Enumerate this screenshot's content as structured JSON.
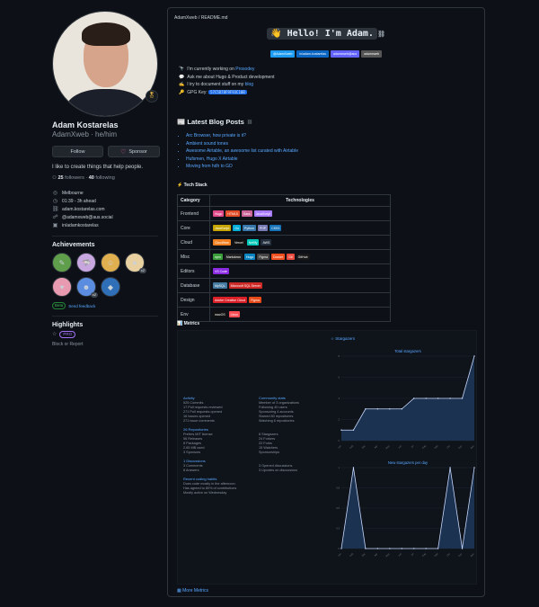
{
  "profile": {
    "name": "Adam Kostarelas",
    "username": "AdamXweb · he/him",
    "status_emoji": "🎖",
    "follow_label": "Follow",
    "sponsor_label": "Sponsor",
    "bio": "I like to create things that help people.",
    "followers_count": "25",
    "followers_label": "followers ·",
    "following_count": "40",
    "following_label": "following",
    "details": [
      {
        "icon": "location-icon",
        "glyph": "◎",
        "text": "Melbourne"
      },
      {
        "icon": "clock-icon",
        "glyph": "◷",
        "text": "01:39 - 3h ahead"
      },
      {
        "icon": "link-icon",
        "glyph": "⛓",
        "text": "adam.kostarelas.com"
      },
      {
        "icon": "mastodon-icon",
        "glyph": "☍",
        "text": "@adamxweb@aus.social"
      },
      {
        "icon": "linkedin-icon",
        "glyph": "▣",
        "text": "in/adamkostarelas"
      }
    ],
    "achievements_title": "Achievements",
    "achievements_row1": [
      {
        "name": "yolo-badge",
        "glyph": "✎",
        "bg": "#5f9e4a",
        "count": ""
      },
      {
        "name": "pull-shark-badge",
        "glyph": "🦈",
        "bg": "#c8a6e0",
        "count": ""
      },
      {
        "name": "quickdraw-badge",
        "glyph": "☺",
        "bg": "#e0b050",
        "count": ""
      },
      {
        "name": "starstruck-badge",
        "glyph": "★",
        "bg": "#e8d0a0",
        "count": "x2"
      }
    ],
    "achievements_row2": [
      {
        "name": "public-sponsor-badge",
        "glyph": "♥",
        "bg": "#e89ab0",
        "count": ""
      },
      {
        "name": "pair-extraordinaire-badge",
        "glyph": "☻",
        "bg": "#5a8de0",
        "count": "x2"
      },
      {
        "name": "arctic-code-vault-badge",
        "glyph": "◆",
        "bg": "#2f6fb8",
        "count": ""
      }
    ],
    "beta_tag": "Beta",
    "beta_text": "Send feedback",
    "highlights_title": "Highlights",
    "pro_label": "PRO",
    "block_report": "Block or Report"
  },
  "readme": {
    "path": "AdamXweb / README.md",
    "hello_text": "👋 Hello! I'm Adam.",
    "social": [
      {
        "label": "@AdamXweb",
        "color": "#1d9bf0"
      },
      {
        "label": "in/adam-kostarelas",
        "color": "#0a66c2"
      },
      {
        "label": "adamxweb@aus",
        "color": "#6364ff"
      },
      {
        "label": "adamxweb",
        "color": "#555"
      }
    ],
    "intro": [
      {
        "glyph": "🔭",
        "text": "I'm currently working on ",
        "link": "Prosodey"
      },
      {
        "glyph": "💬",
        "text": "Ask me about Hugo & Product development",
        "link": ""
      },
      {
        "glyph": "✍",
        "text": "I try to document stuff on my ",
        "link": "blog"
      },
      {
        "glyph": "🔑",
        "text": "GPG Key: ",
        "link": "",
        "code": "57C5D78F9F93C10B"
      }
    ],
    "blog_title": "📰 Latest Blog Posts",
    "blog_posts": [
      "Arc Browser, how private is it?",
      "Ambient sound tones",
      "Awesome Airtable, an awesome list curated with Airtable",
      "Hufsmen, Hugo X Airtable",
      "Moving from hdh to GD"
    ],
    "tech_title": "⚡ Tech Stack",
    "tech_headers": [
      "Category",
      "Technologies"
    ],
    "tech_rows": [
      {
        "category": "Frontend",
        "chips": [
          [
            "Hugo",
            "#e0498a"
          ],
          [
            "HTML5",
            "#e34c26"
          ],
          [
            "Sass",
            "#cc6699"
          ],
          [
            "JavaScript",
            "#a97bff"
          ]
        ]
      },
      {
        "category": "Core",
        "chips": [
          [
            "JavaScript",
            "#c5a400"
          ],
          [
            "Go",
            "#00add8"
          ],
          [
            "Python",
            "#3776ab"
          ],
          [
            "PHP",
            "#777bb4"
          ],
          [
            "CSS3",
            "#1572b6"
          ]
        ]
      },
      {
        "category": "Cloud",
        "chips": [
          [
            "Cloudflare",
            "#f38020"
          ],
          [
            "Vercel",
            "#111111"
          ],
          [
            "Netlify",
            "#00c7b7"
          ],
          [
            "AWS",
            "#232f3e"
          ]
        ]
      },
      {
        "category": "Misc",
        "chips": [
          [
            "npm",
            "#3a9e3a"
          ],
          [
            "Markdown",
            "#222222"
          ],
          [
            "Hugo",
            "#0a84c1"
          ],
          [
            "Figma",
            "#444444"
          ],
          [
            "Docker",
            "#f24e1e"
          ],
          [
            "Git",
            "#e94a3b"
          ],
          [
            "GitHub",
            "#181717"
          ]
        ]
      },
      {
        "category": "Editors",
        "chips": [
          [
            "VS Code",
            "#8a2be2"
          ]
        ]
      },
      {
        "category": "Database",
        "chips": [
          [
            "MySQL",
            "#4479a1"
          ],
          [
            "Microsoft SQL Server",
            "#cc2927"
          ]
        ]
      },
      {
        "category": "Design",
        "chips": [
          [
            "Adobe Creative Cloud",
            "#da1f26"
          ],
          [
            "Figma",
            "#e64a19"
          ]
        ]
      },
      {
        "category": "Env",
        "chips": [
          [
            "macOS",
            "#111111"
          ],
          [
            "Linux",
            "#fa4d56"
          ]
        ]
      }
    ],
    "metrics_title": "📊 Metrics",
    "more_metrics": "More Metrics",
    "metrics": {
      "activity_head": "Activity",
      "activity": [
        "525 Commits",
        "17 Pull requests reviewed",
        "271 Pull requests opened",
        "16 Issues opened",
        "271 issue comments"
      ],
      "community_head": "Community stats",
      "community": [
        "Member of 3 organizations",
        "Following 40 users",
        "Sponsoring 4 accounts",
        "Starred 80 repositories",
        "Watching 6 repositories"
      ],
      "repos_head": "26 Repositories",
      "repos": [
        "Prefers MIT license",
        "56 Releases",
        "8 Packages",
        "2.65 MB used",
        "3 Sponsors"
      ],
      "repos_right": [
        "8 Stargazers",
        "24 Forkers",
        "22 Forks",
        "15 Watchers",
        "Sponsorships"
      ],
      "issues_head": "1 Discussions",
      "issues": [
        "3 Comments",
        "8 Answers"
      ],
      "issues_right": [
        "3 Opened discussions",
        "3 Upvotes on discussions"
      ],
      "recent_head": "Recent coding habits",
      "recent": [
        "Does code mostly in the afternoon",
        "Has agreed to 80% of contributions",
        "Mostly active on Wednesday"
      ],
      "chart1_title": "Total stargazers",
      "chart2_title": "New stargazers per day"
    },
    "chart_data": [
      {
        "type": "area",
        "title": "Total stargazers",
        "x": [
          "Jan",
          "Feb",
          "Mar",
          "Apr",
          "May",
          "Jun",
          "Jul",
          "Aug",
          "Sep",
          "Oct",
          "Nov",
          "Dec"
        ],
        "values": [
          1,
          1,
          3,
          3,
          3,
          3,
          4,
          4,
          4,
          4,
          4,
          8
        ],
        "ylim": [
          0,
          8
        ]
      },
      {
        "type": "area",
        "title": "New stargazers per day",
        "x": [
          "Jan",
          "Feb",
          "Mar",
          "Apr",
          "May",
          "Jun",
          "Jul",
          "Aug",
          "Sep",
          "Oct",
          "Nov",
          "Dec"
        ],
        "values": [
          0,
          1,
          0,
          0,
          0,
          0,
          0,
          0,
          0,
          1,
          0,
          1
        ],
        "ylim": [
          0,
          1
        ]
      }
    ]
  }
}
